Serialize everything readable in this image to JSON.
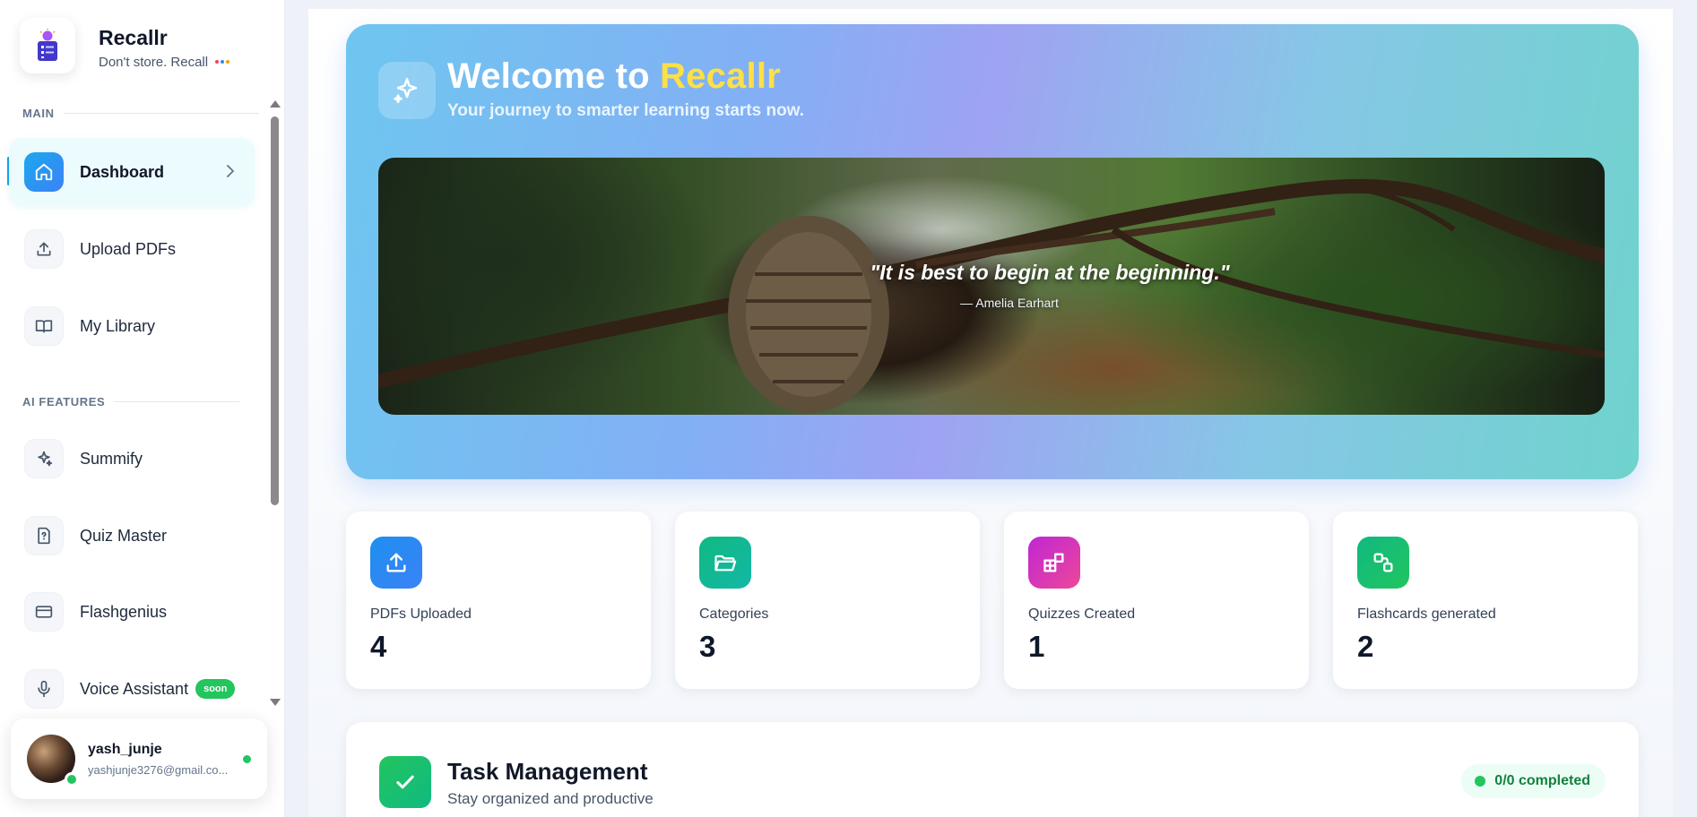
{
  "brand": {
    "name": "Recallr",
    "tagline": "Don't store. Recall",
    "tag_dot_colors": [
      "#f43f5e",
      "#3b82f6",
      "#f59e0b"
    ]
  },
  "sidebar": {
    "sections": [
      {
        "label": "MAIN"
      },
      {
        "label": "AI FEATURES"
      }
    ],
    "items": [
      {
        "label": "Dashboard",
        "icon": "home-icon",
        "active": true
      },
      {
        "label": "Upload PDFs",
        "icon": "upload-icon"
      },
      {
        "label": "My Library",
        "icon": "book-icon"
      },
      {
        "label": "Summify",
        "icon": "sparkles-icon"
      },
      {
        "label": "Quiz Master",
        "icon": "quiz-icon"
      },
      {
        "label": "Flashgenius",
        "icon": "card-icon"
      },
      {
        "label": "Voice Assistant",
        "icon": "mic-icon",
        "badge": "soon"
      }
    ]
  },
  "user": {
    "name": "yash_junje",
    "email": "yashjunje3276@gmail.co..."
  },
  "hero": {
    "title_prefix": "Welcome to ",
    "title_accent": "Recallr",
    "subtitle": "Your journey to smarter learning starts now.",
    "quote": "\"It is best to begin at the beginning.\"",
    "quote_author": "— Amelia Earhart"
  },
  "stats": [
    {
      "label": "PDFs Uploaded",
      "value": "4",
      "icon": "upload-icon",
      "color_from": "#1e8ff0",
      "color_to": "#3b82f6"
    },
    {
      "label": "Categories",
      "value": "3",
      "icon": "folder-open-icon",
      "color_from": "#10b981",
      "color_to": "#14b8a6"
    },
    {
      "label": "Quizzes Created",
      "value": "1",
      "icon": "grid-plus-icon",
      "color_from": "#c026d3",
      "color_to": "#ec4899"
    },
    {
      "label": "Flashcards generated",
      "value": "2",
      "icon": "cards-swap-icon",
      "color_from": "#10b981",
      "color_to": "#22c55e"
    }
  ],
  "tasks": {
    "title": "Task Management",
    "subtitle": "Stay organized and productive",
    "completed_badge": "0/0 completed"
  },
  "colors": {
    "accent": "#0ea5e9",
    "success": "#22c55e",
    "hero_accent": "#fde047"
  }
}
